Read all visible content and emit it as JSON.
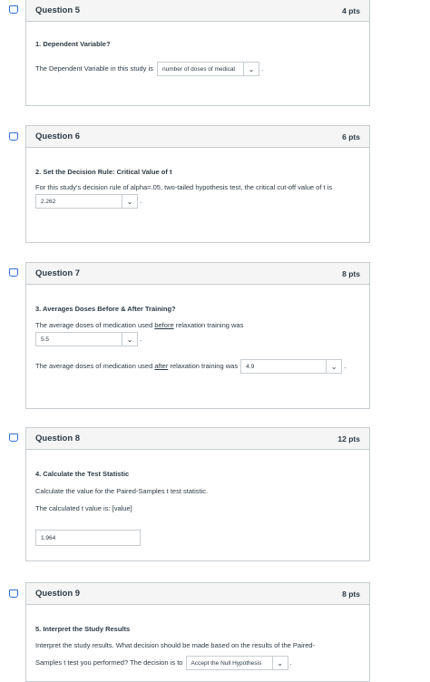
{
  "q5": {
    "heading": "Question 5",
    "points": "4 pts",
    "title": "1. Dependent Variable?",
    "prompt": "The Dependent Variable in this study is",
    "select_value": "number of doses of medicat",
    "after": "."
  },
  "q6": {
    "heading": "Question 6",
    "points": "6 pts",
    "title": "2. Set the Decision Rule: Critical Value of t",
    "prompt": "For this study's decision rule of alpha=.05, two-tailed hypothesis test, the critical cut-off value of t is",
    "select_value": "2.262",
    "after": "."
  },
  "q7": {
    "heading": "Question 7",
    "points": "8 pts",
    "title": "3. Averages Doses Before & After Training?",
    "prompt1_a": "The average doses of medication used ",
    "prompt1_u": "before",
    "prompt1_b": " relaxation training was",
    "select1_value": "5.5",
    "after1": ".",
    "prompt2_a": "The average doses of medication used ",
    "prompt2_u": "after",
    "prompt2_b": " relaxation training was",
    "select2_value": "4.9",
    "after2": "."
  },
  "q8": {
    "heading": "Question 8",
    "points": "12 pts",
    "title": "4. Calculate the Test Statistic",
    "prompt": "Calculate the value for the Paired-Samples t test statistic.",
    "prompt2": "The calculated t value is: [value]",
    "input_value": "1.964"
  },
  "q9": {
    "heading": "Question 9",
    "points": "8 pts",
    "title": "5. Interpret the Study Results",
    "prompt": "Interpret the study results. What decision should be made based on the results of the Paired-",
    "prompt2": "Samples t test you performed? The decision is to",
    "select_value": "Accept the Null Hypothesis",
    "after": "."
  },
  "icons": {
    "flag": "bookmark-flag-icon",
    "dropdown": "chevron-down-icon"
  },
  "colors": {
    "flag": "#2d6fd6",
    "border": "#c7cdd1",
    "header_bg": "#f5f5f5"
  }
}
